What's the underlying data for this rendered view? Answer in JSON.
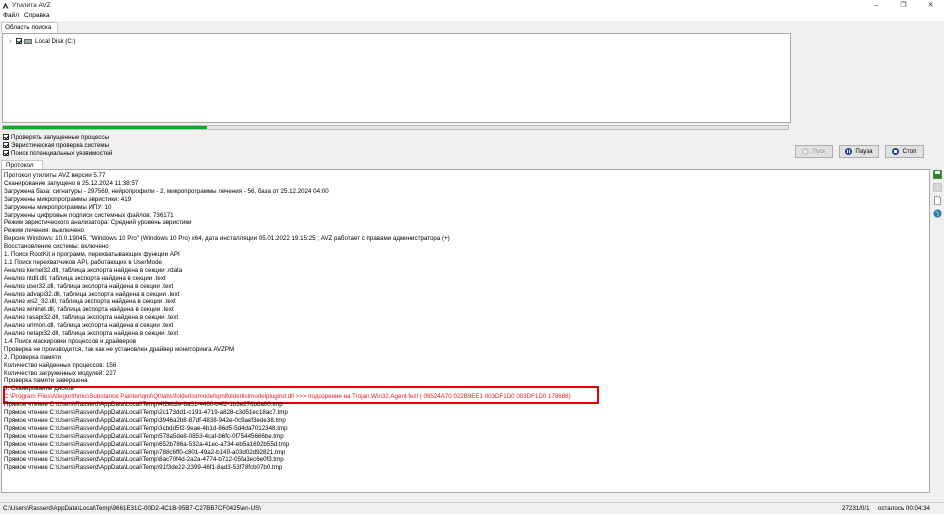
{
  "window": {
    "title": "Утилита AVZ"
  },
  "menu": {
    "file": "Файл",
    "help": "Справка"
  },
  "search_tab": "Область поиска",
  "tree": {
    "drive_label": "Local Disk (C:)"
  },
  "progress": {
    "value": 0.26
  },
  "options": [
    {
      "label": "Проверять запущенные процессы",
      "checked": true
    },
    {
      "label": "Эвристическая проверка системы",
      "checked": true
    },
    {
      "label": "Поиск потенциальных уязвимостей",
      "checked": true
    }
  ],
  "buttons": {
    "start": "Пуск",
    "pause": "Пауза",
    "stop": "Стоп"
  },
  "protocol_tab": "Протокол",
  "log": [
    "Протокол утилиты AVZ версии 5.77",
    "Сканирование запущено в 25.12.2024 11:38:57",
    "Загружена база: сигнатуры - 297569, нейропрофили - 2, микропрограммы лечения - 56, база от 25.12.2024 04:00",
    "Загружены микропрограммы эвристики: 419",
    "Загружены микропрограммы ИПУ: 10",
    "Загружены цифровые подписи системных файлов: 736171",
    "Режим эвристического анализатора: Средний уровень эвристики",
    "Режим лечения: выключено",
    "Версия Windows: 10.0.19045,  \"Windows 10 Pro\" (Windows 10 Pro) x64, дата инсталляции 05.01.2022 19:15:25 ; AVZ работает с правами администратора (+)",
    "Восстановление системы: включено",
    "1. Поиск RootKit и программ, перехватывающих функции API",
    "1.1 Поиск перехватчиков API, работающих в UserMode",
    " Анализ kernel32.dll, таблица экспорта найдена в секции .rdata",
    " Анализ ntdll.dll, таблица экспорта найдена в секции .text",
    " Анализ user32.dll, таблица экспорта найдена в секции .text",
    " Анализ advapi32.dll, таблица экспорта найдена в секции .text",
    " Анализ ws2_32.dll, таблица экспорта найдена в секции .text",
    " Анализ wininet.dll, таблица экспорта найдена в секции .text",
    " Анализ rasapi32.dll, таблица экспорта найдена в секции .text",
    " Анализ urlmon.dll, таблица экспорта найдена в секции .text",
    " Анализ netapi32.dll, таблица экспорта найдена в секции .text",
    "1.4 Поиск маскировки процессов и драйверов",
    " Проверка не производится, так как не установлен драйвер мониторинга AVZPM",
    "2. Проверка памяти",
    " Количество найденных процессов: 156",
    " Количество загруженных модулей: 227",
    "Проверка памяти завершена",
    "3. Сканирование дисков",
    "C:\\Program Files\\Allegorithmic\\Substance Painter\\qml\\Qt\\labs\\folderlistmodel\\qmlfolderlistmodelplugind.dll >>> подозрение на Trojan.Win32.Agent.fezl ( 09524A70 022B9EE1 003DF1D0 003DF1D0 178688)",
    "Прямое чтение C:\\Users\\Rasserd\\AppData\\Local\\Temp\\4f2eb2e-8a31-4460-b4f2-1b3e276b8a00.tmp",
    "Прямое чтение C:\\Users\\Rasserd\\AppData\\Local\\Temp\\2c173dd1-c191-4719-a828-c3d51ec18ac7.tmp",
    "Прямое чтение C:\\Users\\Rasserd\\AppData\\Local\\Temp\\3946a2b8-87df-4838-942e-0c9aef3ede38.tmp",
    "Прямое чтение C:\\Users\\Rasserd\\AppData\\Local\\Temp\\3cbdd5f2-9eae-4b1d-86d5-5d4da7012348.tmp",
    "Прямое чтение C:\\Users\\Rasserd\\AppData\\Local\\Temp\\578a5de8-0853-4caf-b6fc-0f75445666be.tmp",
    "Прямое чтение C:\\Users\\Rasserd\\AppData\\Local\\Temp\\652b786a-532a-41ec-a734-eb5a1692b55d.tmp",
    "Прямое чтение C:\\Users\\Rasserd\\AppData\\Local\\Temp\\788c6ff0-c801-49a2-b149-a03d02d92821.tmp",
    "Прямое чтение C:\\Users\\Rasserd\\AppData\\Local\\Temp\\8ac70f4d-2a2a-4774-b712-05fa3ec6e0f3.tmp",
    "Прямое чтение C:\\Users\\Rasserd\\AppData\\Local\\Temp\\91f3de22-2399-46f1-8ad3-53f78fcb07b0.tmp"
  ],
  "status": {
    "path": "C:\\Users\\Rasserd\\AppData\\Local\\Temp\\9661E31C-00D2-4C1B-95B7-C27BB7CF0425\\en-US\\",
    "count": "27231/0/1",
    "remaining": "осталось 00:04:34"
  }
}
